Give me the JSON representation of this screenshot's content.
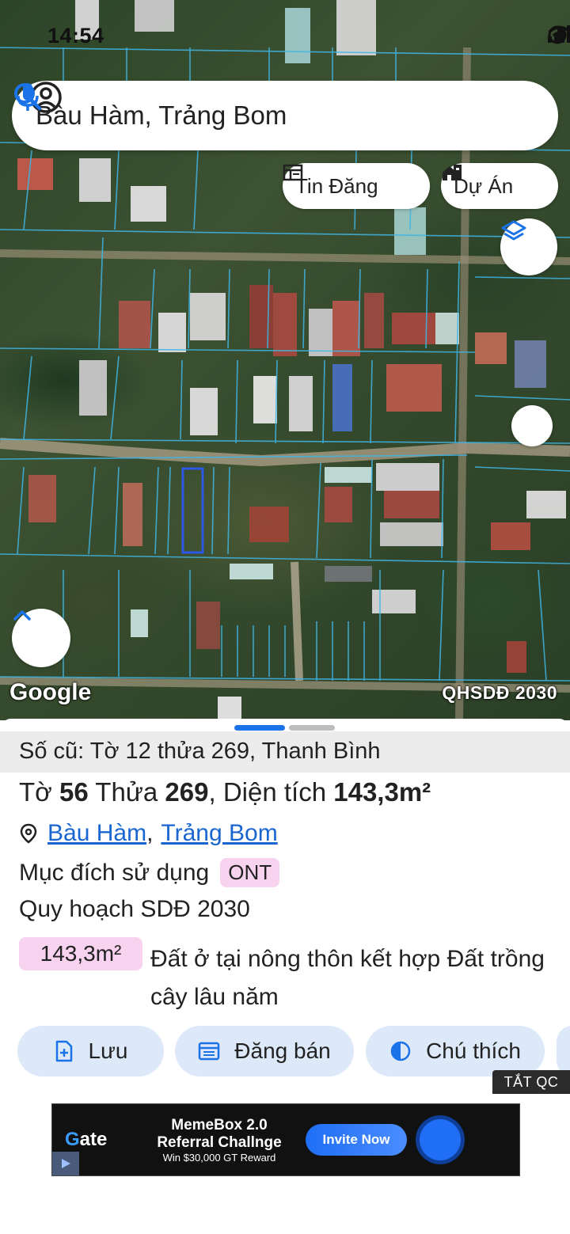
{
  "status_bar": {
    "time": "14:54"
  },
  "search": {
    "query": "Bàu Hàm, Trảng Bom"
  },
  "chips": [
    {
      "label": "Tin Đăng",
      "icon": "newspaper-icon"
    },
    {
      "label": "Dự Án",
      "icon": "buildings-icon"
    }
  ],
  "map": {
    "attribution": "Google",
    "layer_label": "QHSDĐ 2030"
  },
  "parcel": {
    "old_info": "Số cũ: Tờ 12 thửa 269, Thanh Bình",
    "to_label": "Tờ",
    "to_number": "56",
    "thua_label": "Thửa",
    "thua_number": "269",
    "area_label": ", Diện tích",
    "area_value": "143,3m²",
    "location_commune": "Bàu Hàm",
    "location_sep": ",",
    "location_district": "Trảng Bom",
    "purpose_label": "Mục đích sử dụng",
    "purpose_code": "ONT",
    "plan_title": "Quy hoạch SDĐ 2030",
    "plan_area": "143,3m²",
    "plan_desc": "Đất ở tại nông thôn kết hợp Đất trồng cây lâu năm"
  },
  "actions": [
    {
      "label": "Lưu"
    },
    {
      "label": "Đăng bán"
    },
    {
      "label": "Chú thích"
    }
  ],
  "ad": {
    "close_label": "TẮT QC",
    "brand_prefix": "G",
    "brand_rest": "ate",
    "line1": "MemeBox 2.0",
    "line2": "Referral Challnge",
    "line3": "Win $30,000 GT Reward",
    "cta": "Invite Now"
  },
  "colors": {
    "link": "#1a66d0",
    "badge_pink": "#f8d3f0",
    "action_bg": "#dde9f9",
    "accent_blue": "#1a73e8",
    "parcel_line": "#3fb6e6"
  }
}
